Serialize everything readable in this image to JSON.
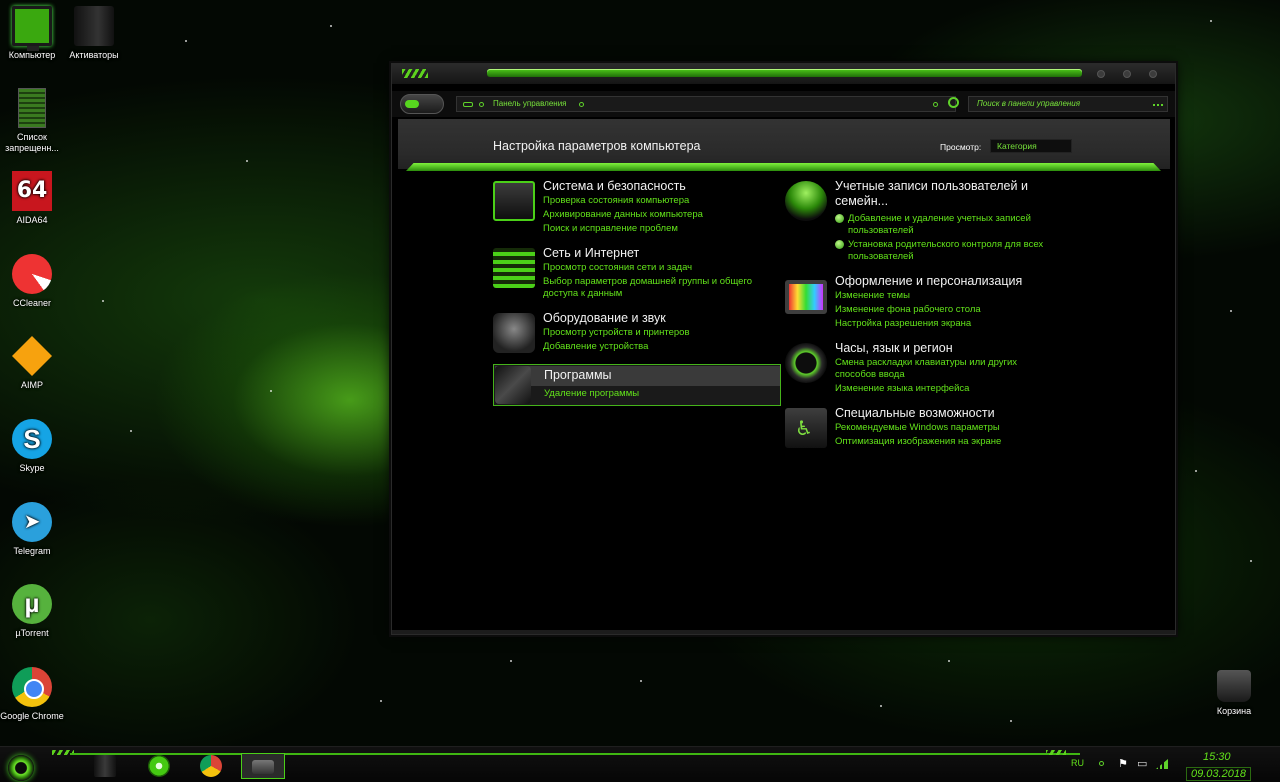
{
  "desktop": {
    "icons": [
      {
        "label": "Компьютер",
        "icon": "monitor-icon"
      },
      {
        "label": "Активаторы",
        "icon": "box-icon"
      },
      {
        "label": "Список запрещенн...",
        "icon": "document-icon"
      },
      {
        "label": "AIDA64",
        "icon": "aida64-icon",
        "glyph": "64"
      },
      {
        "label": "CCleaner",
        "icon": "ccleaner-icon"
      },
      {
        "label": "AIMP",
        "icon": "aimp-icon"
      },
      {
        "label": "Skype",
        "icon": "skype-icon",
        "glyph": "S"
      },
      {
        "label": "Telegram",
        "icon": "telegram-icon",
        "glyph": "➤"
      },
      {
        "label": "µTorrent",
        "icon": "utorrent-icon",
        "glyph": "µ"
      },
      {
        "label": "Google Chrome",
        "icon": "chrome-icon"
      },
      {
        "label": "Корзина",
        "icon": "recycle-bin-icon"
      }
    ]
  },
  "window": {
    "breadcrumb": "Панель управления",
    "search_placeholder": "Поиск в панели управления",
    "page_title": "Настройка параметров компьютера",
    "view_label": "Просмотр:",
    "view_value": "Категория",
    "categories_left": [
      {
        "title": "Система и безопасность",
        "links": [
          "Проверка состояния компьютера",
          "Архивирование данных компьютера",
          "Поиск и исправление проблем"
        ]
      },
      {
        "title": "Сеть и Интернет",
        "links": [
          "Просмотр состояния сети и задач",
          "Выбор параметров домашней группы и общего доступа к данным"
        ]
      },
      {
        "title": "Оборудование и звук",
        "links": [
          "Просмотр устройств и принтеров",
          "Добавление устройства"
        ]
      },
      {
        "title": "Программы",
        "links": [
          "Удаление программы"
        ]
      }
    ],
    "categories_right": [
      {
        "title": "Учетные записи пользователей и семейн...",
        "links": [
          "Добавление и удаление учетных записей пользователей",
          "Установка родительского контроля для всех пользователей"
        ]
      },
      {
        "title": "Оформление и персонализация",
        "links": [
          "Изменение темы",
          "Изменение фона рабочего стола",
          "Настройка разрешения экрана"
        ]
      },
      {
        "title": "Часы, язык и регион",
        "links": [
          "Смена раскладки клавиатуры или других способов ввода",
          "Изменение языка интерфейса"
        ]
      },
      {
        "title": "Специальные возможности",
        "links": [
          "Рекомендуемые Windows параметры",
          "Оптимизация изображения на экране"
        ]
      }
    ]
  },
  "taskbar": {
    "language": "RU",
    "time": "15:30",
    "date": "09.03.2018",
    "apps": [
      "file-manager-icon",
      "media-player-icon",
      "chrome-icon",
      "control-panel-icon"
    ]
  },
  "colors": {
    "accent": "#5fd22a",
    "link": "#62e21a",
    "background": "#000000"
  }
}
